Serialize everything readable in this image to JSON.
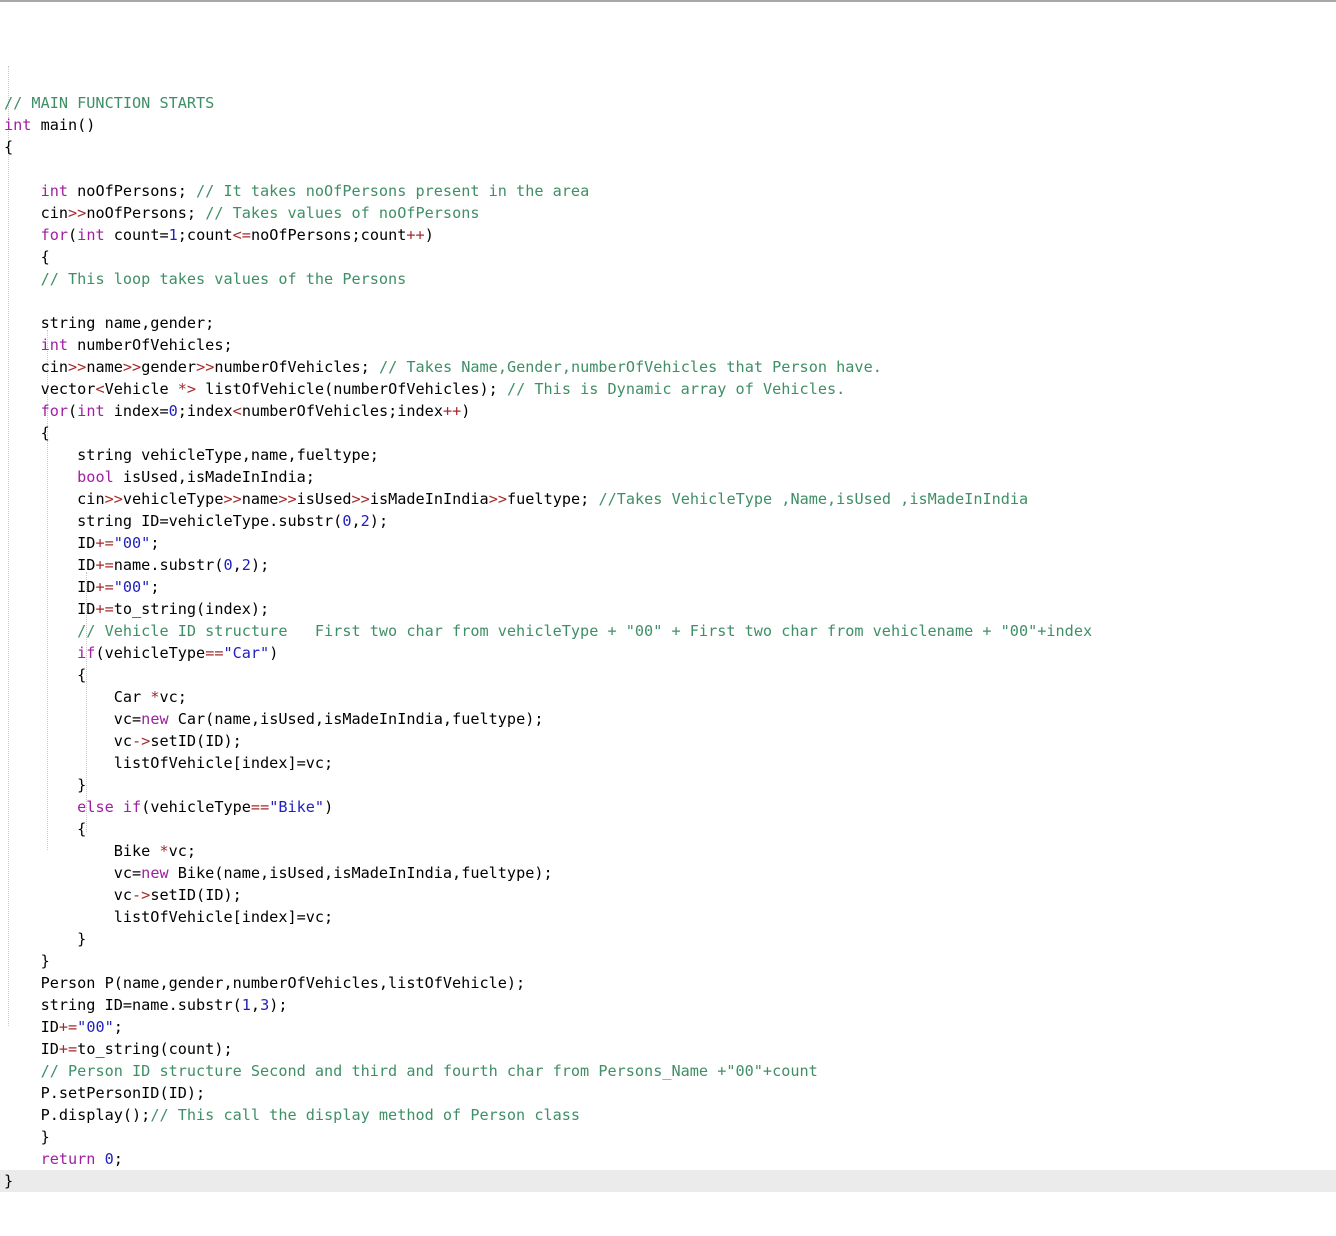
{
  "editor": {
    "language": "C++",
    "colors": {
      "background": "#ffffff",
      "text": "#000000",
      "comment": "#3f8f66",
      "keyword": "#a020a0",
      "string": "#2020c0",
      "number": "#2020c0",
      "operator": "#a52a2a",
      "current_line_highlight": "#ebebeb",
      "indent_guide": "#c9c9c9",
      "top_border": "#a8a8a8"
    },
    "current_line_number": 48,
    "indent_guide_columns": [
      1,
      5,
      9
    ]
  },
  "code": {
    "lines": [
      {
        "n": 1,
        "indent": 0,
        "tokens": [
          [
            "cmt",
            "// MAIN FUNCTION STARTS"
          ]
        ]
      },
      {
        "n": 2,
        "indent": 0,
        "tokens": [
          [
            "kw",
            "int"
          ],
          [
            "pln",
            " main()"
          ]
        ]
      },
      {
        "n": 3,
        "indent": 0,
        "tokens": [
          [
            "pln",
            "{"
          ]
        ]
      },
      {
        "n": 4,
        "indent": 0,
        "tokens": []
      },
      {
        "n": 5,
        "indent": 1,
        "tokens": [
          [
            "kw",
            "int"
          ],
          [
            "pln",
            " noOfPersons; "
          ],
          [
            "cmt",
            "// It takes noOfPersons present in the area"
          ]
        ]
      },
      {
        "n": 6,
        "indent": 1,
        "tokens": [
          [
            "pln",
            "cin"
          ],
          [
            "op",
            ">>"
          ],
          [
            "pln",
            "noOfPersons; "
          ],
          [
            "cmt",
            "// Takes values of noOfPersons"
          ]
        ]
      },
      {
        "n": 7,
        "indent": 1,
        "tokens": [
          [
            "kw",
            "for"
          ],
          [
            "pln",
            "("
          ],
          [
            "kw",
            "int"
          ],
          [
            "pln",
            " count="
          ],
          [
            "num",
            "1"
          ],
          [
            "pln",
            ";count"
          ],
          [
            "op",
            "<="
          ],
          [
            "pln",
            "noOfPersons;count"
          ],
          [
            "op",
            "++"
          ],
          [
            "pln",
            ")"
          ]
        ]
      },
      {
        "n": 8,
        "indent": 1,
        "tokens": [
          [
            "pln",
            "{"
          ]
        ]
      },
      {
        "n": 9,
        "indent": 1,
        "tokens": [
          [
            "cmt",
            "// This loop takes values of the Persons"
          ]
        ]
      },
      {
        "n": 10,
        "indent": 0,
        "tokens": []
      },
      {
        "n": 11,
        "indent": 1,
        "tokens": [
          [
            "pln",
            "string name,gender;"
          ]
        ]
      },
      {
        "n": 12,
        "indent": 1,
        "tokens": [
          [
            "kw",
            "int"
          ],
          [
            "pln",
            " numberOfVehicles;"
          ]
        ]
      },
      {
        "n": 13,
        "indent": 1,
        "tokens": [
          [
            "pln",
            "cin"
          ],
          [
            "op",
            ">>"
          ],
          [
            "pln",
            "name"
          ],
          [
            "op",
            ">>"
          ],
          [
            "pln",
            "gender"
          ],
          [
            "op",
            ">>"
          ],
          [
            "pln",
            "numberOfVehicles; "
          ],
          [
            "cmt",
            "// Takes Name,Gender,numberOfVehicles that Person have."
          ]
        ]
      },
      {
        "n": 14,
        "indent": 1,
        "tokens": [
          [
            "pln",
            "vector"
          ],
          [
            "op",
            "<"
          ],
          [
            "pln",
            "Vehicle "
          ],
          [
            "op",
            "*>"
          ],
          [
            "pln",
            " listOfVehicle(numberOfVehicles); "
          ],
          [
            "cmt",
            "// This is Dynamic array of Vehicles."
          ]
        ]
      },
      {
        "n": 15,
        "indent": 1,
        "tokens": [
          [
            "kw",
            "for"
          ],
          [
            "pln",
            "("
          ],
          [
            "kw",
            "int"
          ],
          [
            "pln",
            " index="
          ],
          [
            "num",
            "0"
          ],
          [
            "pln",
            ";index"
          ],
          [
            "op",
            "<"
          ],
          [
            "pln",
            "numberOfVehicles;index"
          ],
          [
            "op",
            "++"
          ],
          [
            "pln",
            ")"
          ]
        ]
      },
      {
        "n": 16,
        "indent": 1,
        "tokens": [
          [
            "pln",
            "{"
          ]
        ]
      },
      {
        "n": 17,
        "indent": 2,
        "tokens": [
          [
            "pln",
            "string vehicleType,name,fueltype;"
          ]
        ]
      },
      {
        "n": 18,
        "indent": 2,
        "tokens": [
          [
            "kw",
            "bool"
          ],
          [
            "pln",
            " isUsed,isMadeInIndia;"
          ]
        ]
      },
      {
        "n": 19,
        "indent": 2,
        "tokens": [
          [
            "pln",
            "cin"
          ],
          [
            "op",
            ">>"
          ],
          [
            "pln",
            "vehicleType"
          ],
          [
            "op",
            ">>"
          ],
          [
            "pln",
            "name"
          ],
          [
            "op",
            ">>"
          ],
          [
            "pln",
            "isUsed"
          ],
          [
            "op",
            ">>"
          ],
          [
            "pln",
            "isMadeInIndia"
          ],
          [
            "op",
            ">>"
          ],
          [
            "pln",
            "fueltype; "
          ],
          [
            "cmt",
            "//Takes VehicleType ,Name,isUsed ,isMadeInIndia"
          ]
        ]
      },
      {
        "n": 20,
        "indent": 2,
        "tokens": [
          [
            "pln",
            "string ID=vehicleType.substr("
          ],
          [
            "num",
            "0"
          ],
          [
            "pln",
            ","
          ],
          [
            "num",
            "2"
          ],
          [
            "pln",
            ");"
          ]
        ]
      },
      {
        "n": 21,
        "indent": 2,
        "tokens": [
          [
            "pln",
            "ID"
          ],
          [
            "op",
            "+="
          ],
          [
            "str",
            "\"00\""
          ],
          [
            "pln",
            ";"
          ]
        ]
      },
      {
        "n": 22,
        "indent": 2,
        "tokens": [
          [
            "pln",
            "ID"
          ],
          [
            "op",
            "+="
          ],
          [
            "pln",
            "name.substr("
          ],
          [
            "num",
            "0"
          ],
          [
            "pln",
            ","
          ],
          [
            "num",
            "2"
          ],
          [
            "pln",
            ");"
          ]
        ]
      },
      {
        "n": 23,
        "indent": 2,
        "tokens": [
          [
            "pln",
            "ID"
          ],
          [
            "op",
            "+="
          ],
          [
            "str",
            "\"00\""
          ],
          [
            "pln",
            ";"
          ]
        ]
      },
      {
        "n": 24,
        "indent": 2,
        "tokens": [
          [
            "pln",
            "ID"
          ],
          [
            "op",
            "+="
          ],
          [
            "pln",
            "to_string(index);"
          ]
        ]
      },
      {
        "n": 25,
        "indent": 2,
        "tokens": [
          [
            "cmt",
            "// Vehicle ID structure   First two char from vehicleType + \"00\" + First two char from vehiclename + \"00\"+index"
          ]
        ]
      },
      {
        "n": 26,
        "indent": 2,
        "tokens": [
          [
            "kw",
            "if"
          ],
          [
            "pln",
            "(vehicleType"
          ],
          [
            "op",
            "=="
          ],
          [
            "str",
            "\"Car\""
          ],
          [
            "pln",
            ")"
          ]
        ]
      },
      {
        "n": 27,
        "indent": 2,
        "tokens": [
          [
            "pln",
            "{"
          ]
        ]
      },
      {
        "n": 28,
        "indent": 3,
        "tokens": [
          [
            "pln",
            "Car "
          ],
          [
            "op",
            "*"
          ],
          [
            "pln",
            "vc;"
          ]
        ]
      },
      {
        "n": 29,
        "indent": 3,
        "tokens": [
          [
            "pln",
            "vc="
          ],
          [
            "kw",
            "new"
          ],
          [
            "pln",
            " Car(name,isUsed,isMadeInIndia,fueltype);"
          ]
        ]
      },
      {
        "n": 30,
        "indent": 3,
        "tokens": [
          [
            "pln",
            "vc"
          ],
          [
            "op",
            "->"
          ],
          [
            "pln",
            "setID(ID);"
          ]
        ]
      },
      {
        "n": 31,
        "indent": 3,
        "tokens": [
          [
            "pln",
            "listOfVehicle[index]=vc;"
          ]
        ]
      },
      {
        "n": 32,
        "indent": 2,
        "tokens": [
          [
            "pln",
            "}"
          ]
        ]
      },
      {
        "n": 33,
        "indent": 2,
        "tokens": [
          [
            "kw",
            "else"
          ],
          [
            "pln",
            " "
          ],
          [
            "kw",
            "if"
          ],
          [
            "pln",
            "(vehicleType"
          ],
          [
            "op",
            "=="
          ],
          [
            "str",
            "\"Bike\""
          ],
          [
            "pln",
            ")"
          ]
        ]
      },
      {
        "n": 34,
        "indent": 2,
        "tokens": [
          [
            "pln",
            "{"
          ]
        ]
      },
      {
        "n": 35,
        "indent": 3,
        "tokens": [
          [
            "pln",
            "Bike "
          ],
          [
            "op",
            "*"
          ],
          [
            "pln",
            "vc;"
          ]
        ]
      },
      {
        "n": 36,
        "indent": 3,
        "tokens": [
          [
            "pln",
            "vc="
          ],
          [
            "kw",
            "new"
          ],
          [
            "pln",
            " Bike(name,isUsed,isMadeInIndia,fueltype);"
          ]
        ]
      },
      {
        "n": 37,
        "indent": 3,
        "tokens": [
          [
            "pln",
            "vc"
          ],
          [
            "op",
            "->"
          ],
          [
            "pln",
            "setID(ID);"
          ]
        ]
      },
      {
        "n": 38,
        "indent": 3,
        "tokens": [
          [
            "pln",
            "listOfVehicle[index]=vc;"
          ]
        ]
      },
      {
        "n": 39,
        "indent": 2,
        "tokens": [
          [
            "pln",
            "}"
          ]
        ]
      },
      {
        "n": 40,
        "indent": 1,
        "tokens": [
          [
            "pln",
            "}"
          ]
        ]
      },
      {
        "n": 41,
        "indent": 1,
        "tokens": [
          [
            "pln",
            "Person P(name,gender,numberOfVehicles,listOfVehicle);"
          ]
        ]
      },
      {
        "n": 42,
        "indent": 1,
        "tokens": [
          [
            "pln",
            "string ID=name.substr("
          ],
          [
            "num",
            "1"
          ],
          [
            "pln",
            ","
          ],
          [
            "num",
            "3"
          ],
          [
            "pln",
            ");"
          ]
        ]
      },
      {
        "n": 43,
        "indent": 1,
        "tokens": [
          [
            "pln",
            "ID"
          ],
          [
            "op",
            "+="
          ],
          [
            "str",
            "\"00\""
          ],
          [
            "pln",
            ";"
          ]
        ]
      },
      {
        "n": 44,
        "indent": 1,
        "tokens": [
          [
            "pln",
            "ID"
          ],
          [
            "op",
            "+="
          ],
          [
            "pln",
            "to_string(count);"
          ]
        ]
      },
      {
        "n": 45,
        "indent": 1,
        "tokens": [
          [
            "cmt",
            "// Person ID structure Second and third and fourth char from Persons_Name +\"00\"+count"
          ]
        ]
      },
      {
        "n": 46,
        "indent": 1,
        "tokens": [
          [
            "pln",
            "P.setPersonID(ID);"
          ]
        ]
      },
      {
        "n": 47,
        "indent": 1,
        "tokens": [
          [
            "pln",
            "P.display();"
          ],
          [
            "cmt",
            "// This call the display method of Person class"
          ]
        ]
      },
      {
        "n": 48,
        "indent": 1,
        "tokens": [
          [
            "pln",
            "}"
          ]
        ]
      },
      {
        "n": 49,
        "indent": 1,
        "tokens": [
          [
            "kw",
            "return"
          ],
          [
            "pln",
            " "
          ],
          [
            "num",
            "0"
          ],
          [
            "pln",
            ";"
          ]
        ]
      },
      {
        "n": 50,
        "indent": 0,
        "current": true,
        "tokens": [
          [
            "pln",
            "}"
          ]
        ]
      }
    ]
  }
}
